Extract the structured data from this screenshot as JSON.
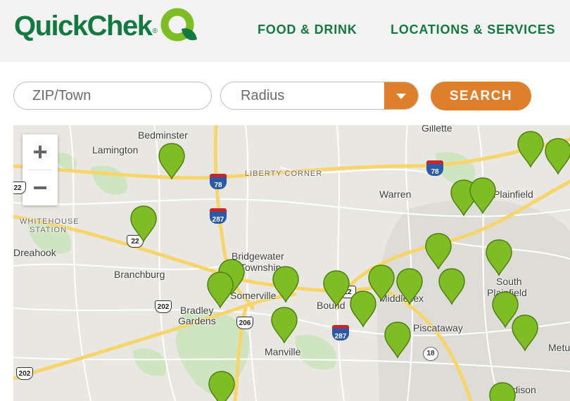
{
  "header": {
    "logo_text": "QuickChek",
    "logo_reg": "®",
    "nav": [
      "FOOD & DRINK",
      "LOCATIONS & SERVICES"
    ]
  },
  "search": {
    "zip_placeholder": "ZIP/Town",
    "radius_label": "Radius",
    "search_label": "SEARCH"
  },
  "colors": {
    "brand_green": "#127a3e",
    "accent_orange": "#e07f2b",
    "marker_green": "#7fbd24"
  },
  "map": {
    "zoom_in": "+",
    "zoom_out": "−",
    "places": [
      "Gillette",
      "Bedminster",
      "Lamington",
      "LIBERTY CORNER",
      "Warren",
      "Plainfield",
      "WHITEHOUSE",
      "STATION",
      "Dreahook",
      "Bridgewater",
      "Township",
      "Branchburg",
      "Somerville",
      "Bound",
      "Middlesex",
      "South",
      "Plainfield",
      "Bradley",
      "Gardens",
      "Piscataway",
      "Manville",
      "Metu",
      "Edison"
    ],
    "routes": [
      "22",
      "22",
      "78",
      "78",
      "287",
      "202",
      "206",
      "22",
      "287",
      "18",
      "202"
    ],
    "store_count": 22
  }
}
